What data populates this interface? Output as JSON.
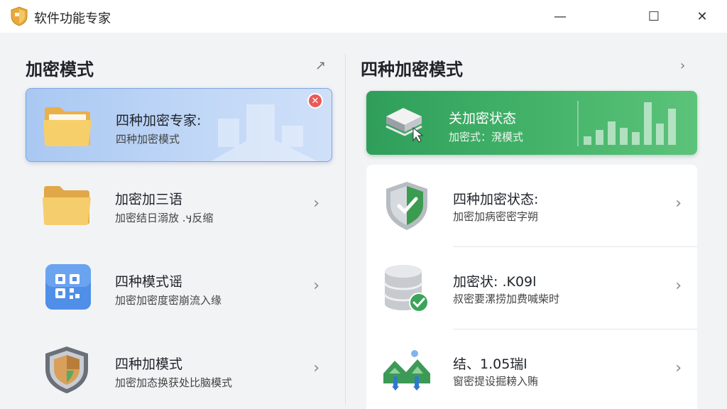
{
  "window": {
    "title": "软件功能专家",
    "minimize": "—",
    "maximize": "☐",
    "close": "✕"
  },
  "left": {
    "title": "加密模式",
    "expand_icon": "↗",
    "cards": [
      {
        "title": "四种加密专家:",
        "sub": "四种加密模式",
        "icon": "folder-open-icon",
        "active": true
      },
      {
        "title": "加密加三语",
        "sub": "加密结日溺放 .ӌ反缩",
        "icon": "folder-icon"
      },
      {
        "title": "四种模式谣",
        "sub": "加密加密度密崩流入缘",
        "icon": "qr-code-icon"
      },
      {
        "title": "四种加模式",
        "sub": "加密加态换获处比脑模式",
        "icon": "shield-icon"
      }
    ]
  },
  "right": {
    "title": "四种加密模式",
    "chevron": "›",
    "status": {
      "title": "关加密状态",
      "sub": "加密式：溌模式",
      "bars": [
        0.2,
        0.35,
        0.55,
        0.4,
        0.3,
        1.0,
        0.5,
        0.85
      ]
    },
    "items": [
      {
        "title": "四种加密状态:",
        "sub": "加密加病密密字朔",
        "icon": "shield-check-icon"
      },
      {
        "title": "加密状: .K09l",
        "sub": "叔密要漯捞加费喊柴时",
        "icon": "database-check-icon"
      },
      {
        "title": "结、1.05瑞l",
        "sub": "窗密提设掘耪入贿",
        "icon": "network-house-icon"
      }
    ]
  },
  "colors": {
    "accent_blue": "#a9c8f2",
    "accent_green": "#45b46a",
    "close_red": "#e85a5a"
  }
}
